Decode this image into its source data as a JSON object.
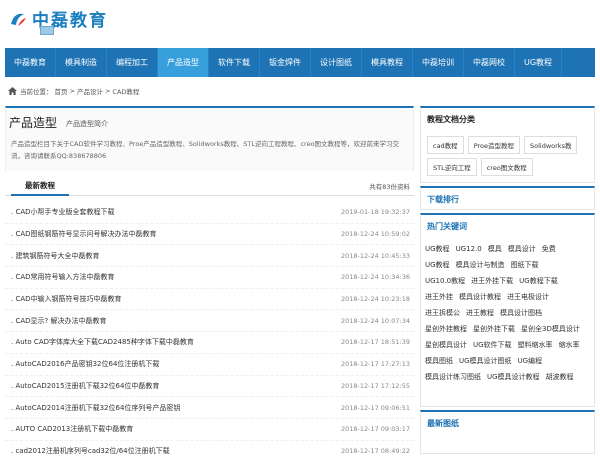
{
  "logo": {
    "text": "中磊教育"
  },
  "nav": {
    "items": [
      {
        "label": "中磊教育",
        "active": false
      },
      {
        "label": "模具制造",
        "active": false
      },
      {
        "label": "编程加工",
        "active": false
      },
      {
        "label": "产品造型",
        "active": true
      },
      {
        "label": "软件下载",
        "active": false
      },
      {
        "label": "钣金焊件",
        "active": false
      },
      {
        "label": "设计图纸",
        "active": false
      },
      {
        "label": "模具教程",
        "active": false
      },
      {
        "label": "中磊培训",
        "active": false
      },
      {
        "label": "中磊网校",
        "active": false
      },
      {
        "label": "UG教程",
        "active": false
      }
    ]
  },
  "breadcrumb": {
    "prefix": "当前位置：",
    "home": "首页",
    "sep": ">",
    "level1": "产品设计",
    "level2": "CAD教程"
  },
  "category": {
    "title": "产品造型",
    "intro_link": "产品造型简介",
    "description": "产品造型栏目下关于CAD软件学习教程、Proe产品造型教程、Solidworks教程、STL逆向工程教程、creo图文教程等，欢迎前来学习交流，咨询请联系QQ:838678806"
  },
  "list": {
    "tab_label": "最新教程",
    "count_text": "共有83份资料",
    "rows": [
      {
        "title": ". CAD小帮手专业版全套教程下载",
        "date": "2019-01-18 19:32:37"
      },
      {
        "title": ". CAD图纸钢筋符号显示问号解决办法中磊教育",
        "date": "2018-12-24 10:59:02"
      },
      {
        "title": ". 建筑钢筋符号大全中磊教育",
        "date": "2018-12-24 10:45:33"
      },
      {
        "title": ". CAD常用符号输入方法中磊教育",
        "date": "2018-12-24 10:34:36"
      },
      {
        "title": ". CAD中输入钢筋符号技巧中磊教育",
        "date": "2018-12-24 10:23:18"
      },
      {
        "title": ". CAD显示? 解决办法中磊教育",
        "date": "2018-12-24 10:07:34"
      },
      {
        "title": ". Auto CAD字体库大全下载CAD2485种字体下载中磊教育",
        "date": "2018-12-17 18:51:39"
      },
      {
        "title": ". AutoCAD2016产品密钥32位64位注册机下载",
        "date": "2018-12-17 17:27:13"
      },
      {
        "title": ". AutoCAD2015注册机下载32位64位中磊教育",
        "date": "2018-12-17 17:12:55"
      },
      {
        "title": ". AutoCAD2014注册机下载32位64位序列号产品密钥",
        "date": "2018-12-17 09:06:51"
      },
      {
        "title": ". AUTO CAD2013注册机下载中磊教育",
        "date": "2018-12-17 09:03:17"
      },
      {
        "title": ". cad2012注册机序列号cad32位/64位注册机下载",
        "date": "2018-12-17 08:49:22"
      }
    ]
  },
  "sidebar": {
    "doc_categories": {
      "title": "教程文档分类",
      "tags": [
        "cad教程",
        "Proe造型教程",
        "Solidworks教",
        "STL逆向工程",
        "creo图文教程"
      ]
    },
    "downloads": {
      "title": "下载排行"
    },
    "keywords": {
      "title": "热门关键词",
      "items": [
        "UG教程",
        "UG12.0",
        "模具",
        "模具设计",
        "免费",
        "UG教程",
        "模具设计与制造",
        "图纸下载",
        "UG10.0教程",
        "进王外挂下载",
        "UG教程下载",
        "进王外挂",
        "模具设计教程",
        "进王电极设计",
        "进王拆模公",
        "进王教程",
        "模具设计图档",
        "星创外挂教程",
        "星创外挂下载",
        "星创全3D模具设计",
        "星创模具设计",
        "UG软件下载",
        "塑料缩水率",
        "缩水率",
        "模具图纸",
        "UG模具设计图纸",
        "UG编程",
        "模具设计练习图纸",
        "UG模具设计教程",
        "胡波教程"
      ]
    },
    "latest_drawings": {
      "title": "最新图纸"
    }
  }
}
